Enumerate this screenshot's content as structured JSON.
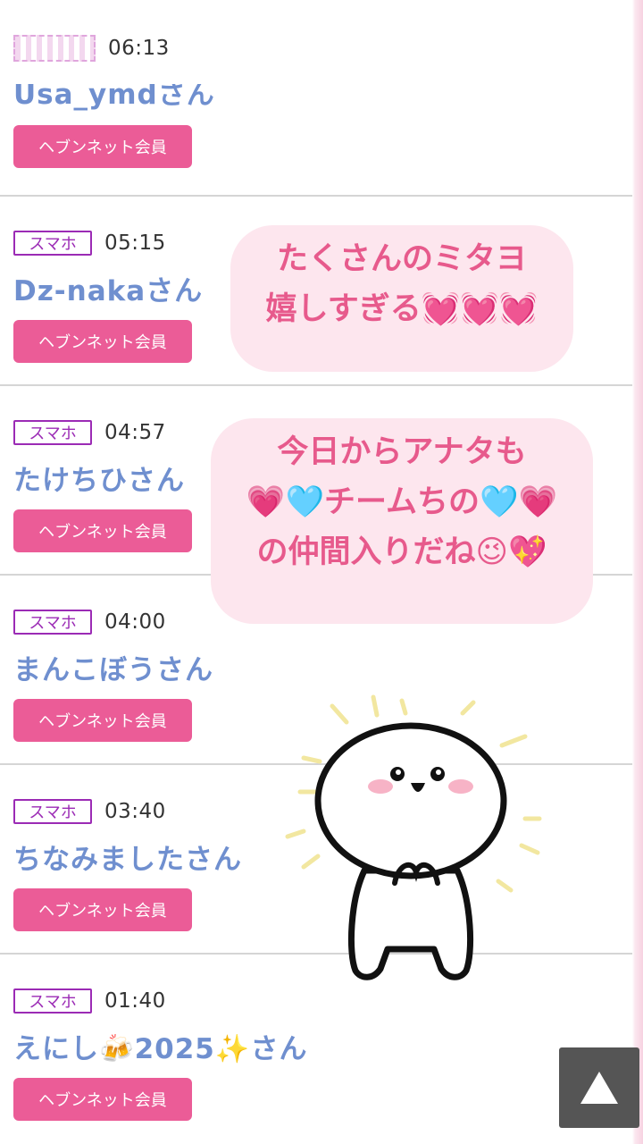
{
  "entries": [
    {
      "badge": "",
      "time": "06:13",
      "name": "Usa_ymdさん",
      "member_label": "ヘブンネット会員"
    },
    {
      "badge": "スマホ",
      "time": "05:15",
      "name": "Dz-nakaさん",
      "member_label": "ヘブンネット会員"
    },
    {
      "badge": "スマホ",
      "time": "04:57",
      "name": "たけちひさん",
      "member_label": "ヘブンネット会員"
    },
    {
      "badge": "スマホ",
      "time": "04:00",
      "name": "まんこぼうさん",
      "member_label": "ヘブンネット会員"
    },
    {
      "badge": "スマホ",
      "time": "03:40",
      "name": "ちなみましたさん",
      "member_label": "ヘブンネット会員"
    },
    {
      "badge": "スマホ",
      "time": "01:40",
      "name": "えにし🍻2025✨さん",
      "member_label": "ヘブンネット会員"
    }
  ],
  "overlay": {
    "bubble1": [
      "たくさんのミタヨ",
      "嬉しすぎる💓💓💓"
    ],
    "bubble2": [
      "今日からアナタも",
      "💗🩵チームちの🩵💗",
      "の仲間入りだね😉💖"
    ]
  },
  "scroll_top_icon": "triangle-up-icon",
  "colors": {
    "accent": "#eb5c97",
    "name": "#6f8fcf",
    "badge": "#9b2bb5",
    "bubble_bg": "#fde6ee",
    "bubble_text": "#e75a8c"
  }
}
